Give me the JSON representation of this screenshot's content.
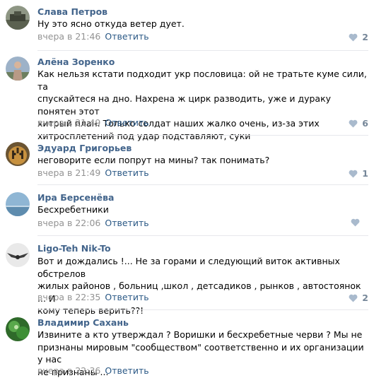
{
  "colors": {
    "author": "#42648b",
    "reply": "#2a5885",
    "meta": "#939393",
    "like": "#768799",
    "separator": "#e7e8ec"
  },
  "comments": [
    {
      "author": "Слава Петров",
      "text": "Ну это ясно откуда ветер дует.",
      "time": "вчера в 21:46",
      "reply": "Ответить",
      "likes": "2",
      "avatar_icon": "avatar-dark-photo"
    },
    {
      "author": "Алёна Зоренко",
      "text": "Как нельзя кстати подходит укр пословица: ой не тратьте куме сили, та\nспускайтеся на дно. Нахрена ж цирк разводить, уже и дураку понятен этот\nхитрый план. Только солдат наших жалко очень, из-за этих\nхитросплетений под удар подставляют, суки",
      "time": "вчера в 21:49",
      "reply": "Ответить",
      "likes": "6",
      "avatar_icon": "avatar-person-photo"
    },
    {
      "author": "Эдуард Григорьев",
      "text": "неговорите если попрут на мины? так понимать?",
      "time": "вчера в 21:49",
      "reply": "Ответить",
      "likes": "1",
      "avatar_icon": "avatar-tiger-photo"
    },
    {
      "author": "Ира Берсенёва",
      "text": "Бесхребетники",
      "time": "вчера в 22:06",
      "reply": "Ответить",
      "likes": "",
      "avatar_icon": "avatar-sky-photo"
    },
    {
      "author": "Ligo-Teh Nik-To",
      "text": "Вот и дождались !... Не за горами и следующий виток активных обстрелов\nжилых районов , больниц ,школ , детсадиков , рынков , автостоянок ... И\nкому теперь верить??!",
      "time": "вчера в 22:35",
      "reply": "Ответить",
      "likes": "2",
      "avatar_icon": "avatar-bird-photo"
    },
    {
      "author": "Владимир Сахань",
      "text": "Извините а кто утверждал ? Воришки и бесхребетные черви ? Мы не\nпризнаны мировым \"сообществом\" соответственно и их организации у нас\nне признаны ...",
      "time": "вчера в 22:36",
      "reply": "Ответить",
      "likes": "",
      "avatar_icon": "avatar-green-photo"
    }
  ]
}
